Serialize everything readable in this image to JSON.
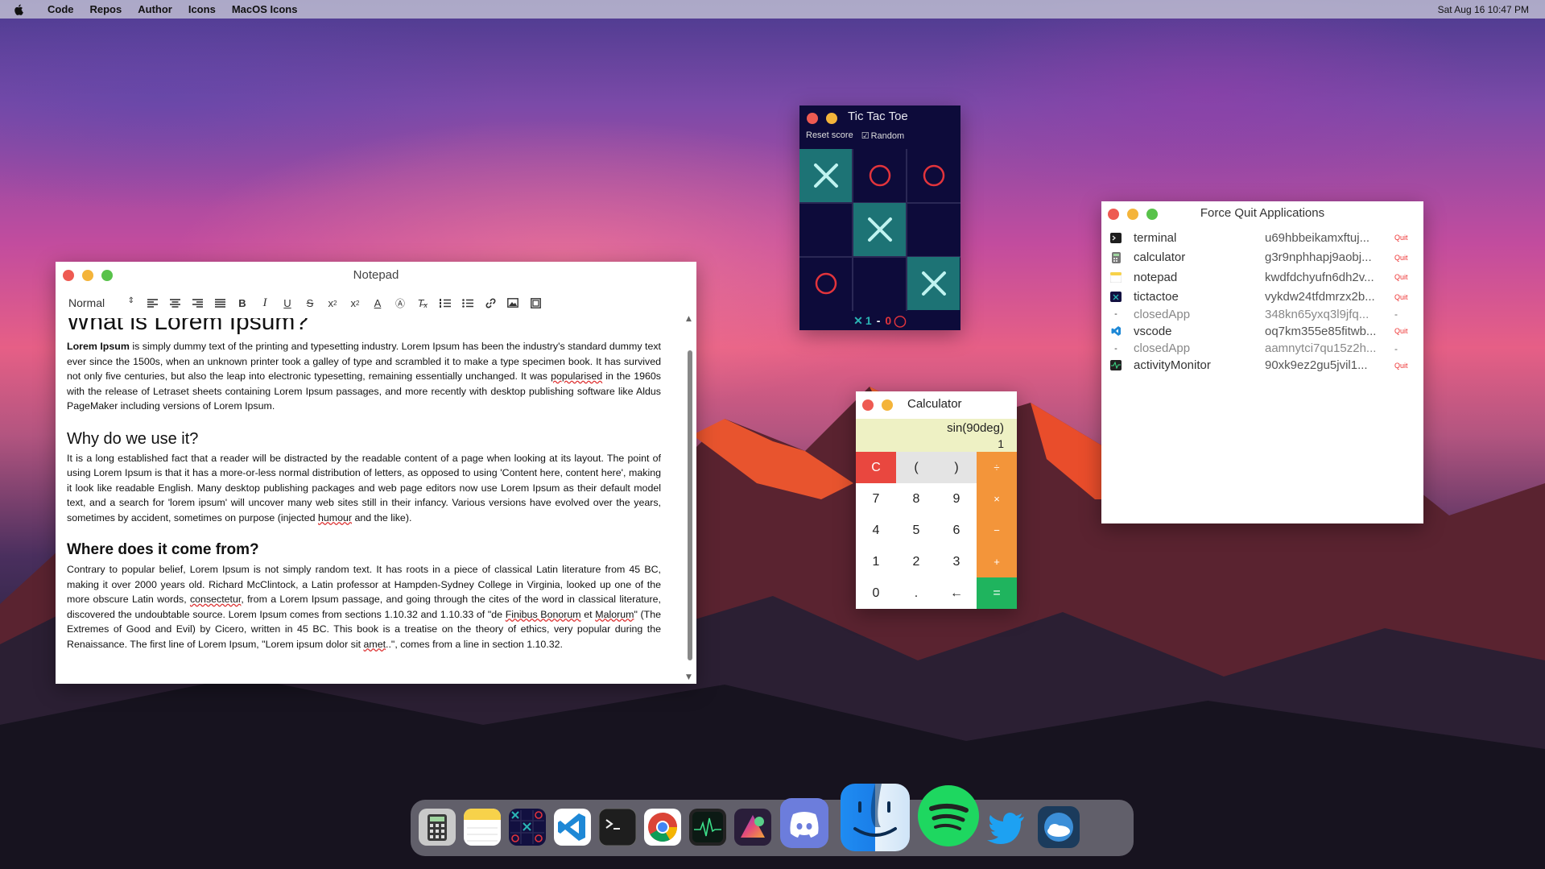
{
  "menubar": {
    "items": [
      "Code",
      "Repos",
      "Author",
      "Icons",
      "MacOS Icons"
    ],
    "clock": "Sat Aug 16 10:47 PM"
  },
  "notepad": {
    "title": "Notepad",
    "format_select": "Normal",
    "toolbar_icons": [
      "align-left-icon",
      "align-center-icon",
      "align-right-icon",
      "align-justify-icon",
      "bold-icon",
      "italic-icon",
      "underline-icon",
      "strikethrough-icon",
      "subscript-icon",
      "superscript-icon",
      "text-color-icon",
      "highlight-icon",
      "clear-format-icon",
      "ordered-list-icon",
      "bullet-list-icon",
      "link-icon",
      "image-icon",
      "video-icon"
    ],
    "heading1": "What is Lorem Ipsum?",
    "para1_bold": "Lorem Ipsum",
    "para1_a": " is simply dummy text of the printing and typesetting industry. Lorem Ipsum has been the industry's standard dummy text ever since the 1500s, when an unknown printer took a galley of type and scrambled it to make a type specimen book. It has survived not only five centuries, but also the leap into electronic typesetting, remaining essentially unchanged. It was ",
    "para1_sq": "popularised",
    "para1_b": " in the 1960s with the release of Letraset sheets containing Lorem Ipsum passages, and more recently with desktop publishing software like Aldus PageMaker including versions of Lorem Ipsum.",
    "heading2": "Why do we use it?",
    "para2_a": "It is a long established fact that a reader will be distracted by the readable content of a page when looking at its layout. The point of using Lorem Ipsum is that it has a more-or-less normal distribution of letters, as opposed to using 'Content here, content here', making it look like readable English. Many desktop publishing packages and web page editors now use Lorem Ipsum as their default model text, and a search for 'lorem ipsum' will uncover many web sites still in their infancy. Various versions have evolved over the years, sometimes by accident, sometimes on purpose (injected ",
    "para2_sq": "humour",
    "para2_b": " and the like).",
    "heading3": "Where does it come from?",
    "para3_a": "Contrary to popular belief, Lorem Ipsum is not simply random text. It has roots in a piece of classical Latin literature from 45 BC, making it over 2000 years old. Richard McClintock, a Latin professor at Hampden-Sydney College in Virginia, looked up one of the more obscure Latin words, ",
    "para3_sq1": "consectetur",
    "para3_b": ", from a Lorem Ipsum passage, and going through the cites of the word in classical literature, discovered the undoubtable source. Lorem Ipsum comes from sections 1.10.32 and 1.10.33 of \"de ",
    "para3_sq2": "Finibus Bonorum",
    "para3_c": " et ",
    "para3_sq3": "Malorum",
    "para3_d": "\" (The Extremes of Good and Evil) by Cicero, written in 45 BC. This book is a treatise on the theory of ethics, very popular during the Renaissance. The first line of Lorem Ipsum, \"Lorem ipsum dolor sit ",
    "para3_sq4": "amet",
    "para3_e": "..\", comes from a line in section 1.10.32."
  },
  "tictactoe": {
    "title": "Tic Tac Toe",
    "reset_label": "Reset score",
    "random_label": "Random",
    "random_checked": true,
    "board": [
      "X",
      "O",
      "O",
      "",
      "X",
      "",
      "O",
      "",
      "X"
    ],
    "score_x": "1",
    "score_sep": "-",
    "score_o": "0",
    "x_color": "#1d7375",
    "o_color": "#e2343c"
  },
  "calculator": {
    "title": "Calculator",
    "expression": "sin(90deg)",
    "result": "1",
    "keys": [
      "C",
      "(",
      ")",
      "÷",
      "7",
      "8",
      "9",
      "×",
      "4",
      "5",
      "6",
      "−",
      "1",
      "2",
      "3",
      "+",
      "0",
      ".",
      "←",
      "="
    ]
  },
  "force_quit": {
    "title": "Force Quit Applications",
    "quit_label": "Quit",
    "rows": [
      {
        "icon": "terminal-icon",
        "name": "terminal",
        "pid": "u69hbbeikamxftuj...",
        "action": "Quit",
        "closed": false
      },
      {
        "icon": "calculator-icon",
        "name": "calculator",
        "pid": "g3r9nphhapj9aobj...",
        "action": "Quit",
        "closed": false
      },
      {
        "icon": "notepad-icon",
        "name": "notepad",
        "pid": "kwdfdchyufn6dh2v...",
        "action": "Quit",
        "closed": false
      },
      {
        "icon": "tictactoe-icon",
        "name": "tictactoe",
        "pid": "vykdw24tfdmrzx2b...",
        "action": "Quit",
        "closed": false
      },
      {
        "icon": "dash",
        "name": "closedApp",
        "pid": "348kn65yxq3l9jfq...",
        "action": "-",
        "closed": true
      },
      {
        "icon": "vscode-icon",
        "name": "vscode",
        "pid": "oq7km355e85fitwb...",
        "action": "Quit",
        "closed": false
      },
      {
        "icon": "dash",
        "name": "closedApp",
        "pid": "aamnytci7qu15z2h...",
        "action": "-",
        "closed": true
      },
      {
        "icon": "activity-monitor-icon",
        "name": "activityMonitor",
        "pid": "90xk9ez2gu5jvil1...",
        "action": "Quit",
        "closed": false
      }
    ]
  },
  "dock": {
    "apps": [
      "calculator-icon",
      "notes-icon",
      "tictactoe-icon",
      "vscode-icon",
      "terminal-icon",
      "chrome-icon",
      "activity-monitor-icon",
      "nova-icon",
      "discord-icon",
      "finder-icon",
      "spotify-icon",
      "twitter-icon",
      "weather-icon"
    ]
  },
  "colors": {
    "accent_red": "#ee5a52",
    "accent_yellow": "#f4b43a",
    "accent_green": "#58c24a",
    "calc_op": "#f3953a",
    "calc_eq": "#1fb45e"
  }
}
